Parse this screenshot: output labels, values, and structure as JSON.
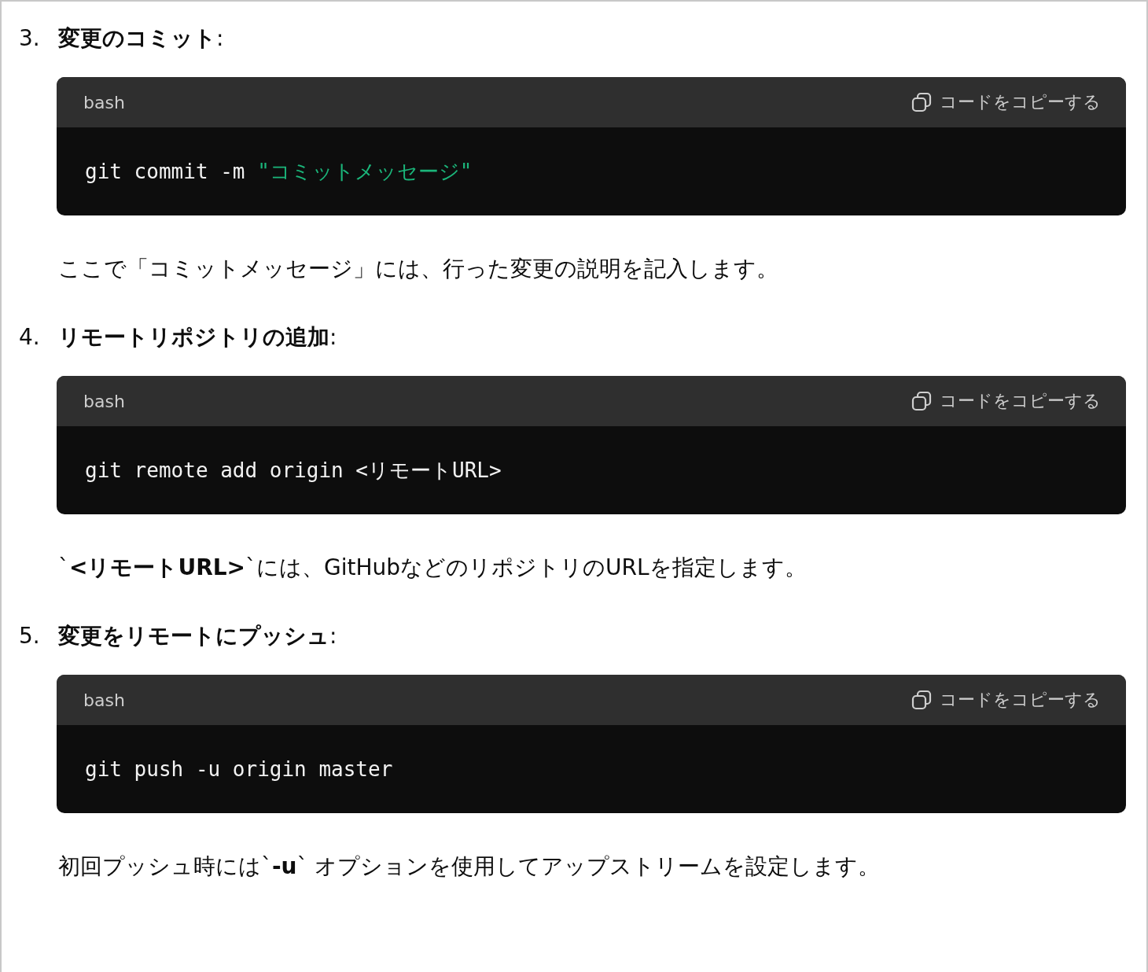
{
  "steps": [
    {
      "number": "3.",
      "title": "**変更のコミット**:",
      "code": {
        "language": "bash",
        "copy_label": "コードをコピーする",
        "tokens": [
          {
            "kind": "plain",
            "text": "git commit -m "
          },
          {
            "kind": "string",
            "text": "\"コミットメッセージ\""
          }
        ]
      },
      "note": "ここで「コミットメッセージ」には、行った変更の説明を記入します。"
    },
    {
      "number": "4.",
      "title": "**リモートリポジトリの追加**:",
      "code": {
        "language": "bash",
        "copy_label": "コードをコピーする",
        "tokens": [
          {
            "kind": "plain",
            "text": "git remote add origin <リモートURL>"
          }
        ]
      },
      "note": "`**<リモートURL>**`には、GitHubなどのリポジトリのURLを指定します。"
    },
    {
      "number": "5.",
      "title": "**変更をリモートにプッシュ**:",
      "code": {
        "language": "bash",
        "copy_label": "コードをコピーする",
        "tokens": [
          {
            "kind": "plain",
            "text": "git push -u origin master"
          }
        ]
      },
      "note": "初回プッシュ時には`**-u**` オプションを使用してアップストリームを設定します。"
    }
  ]
}
